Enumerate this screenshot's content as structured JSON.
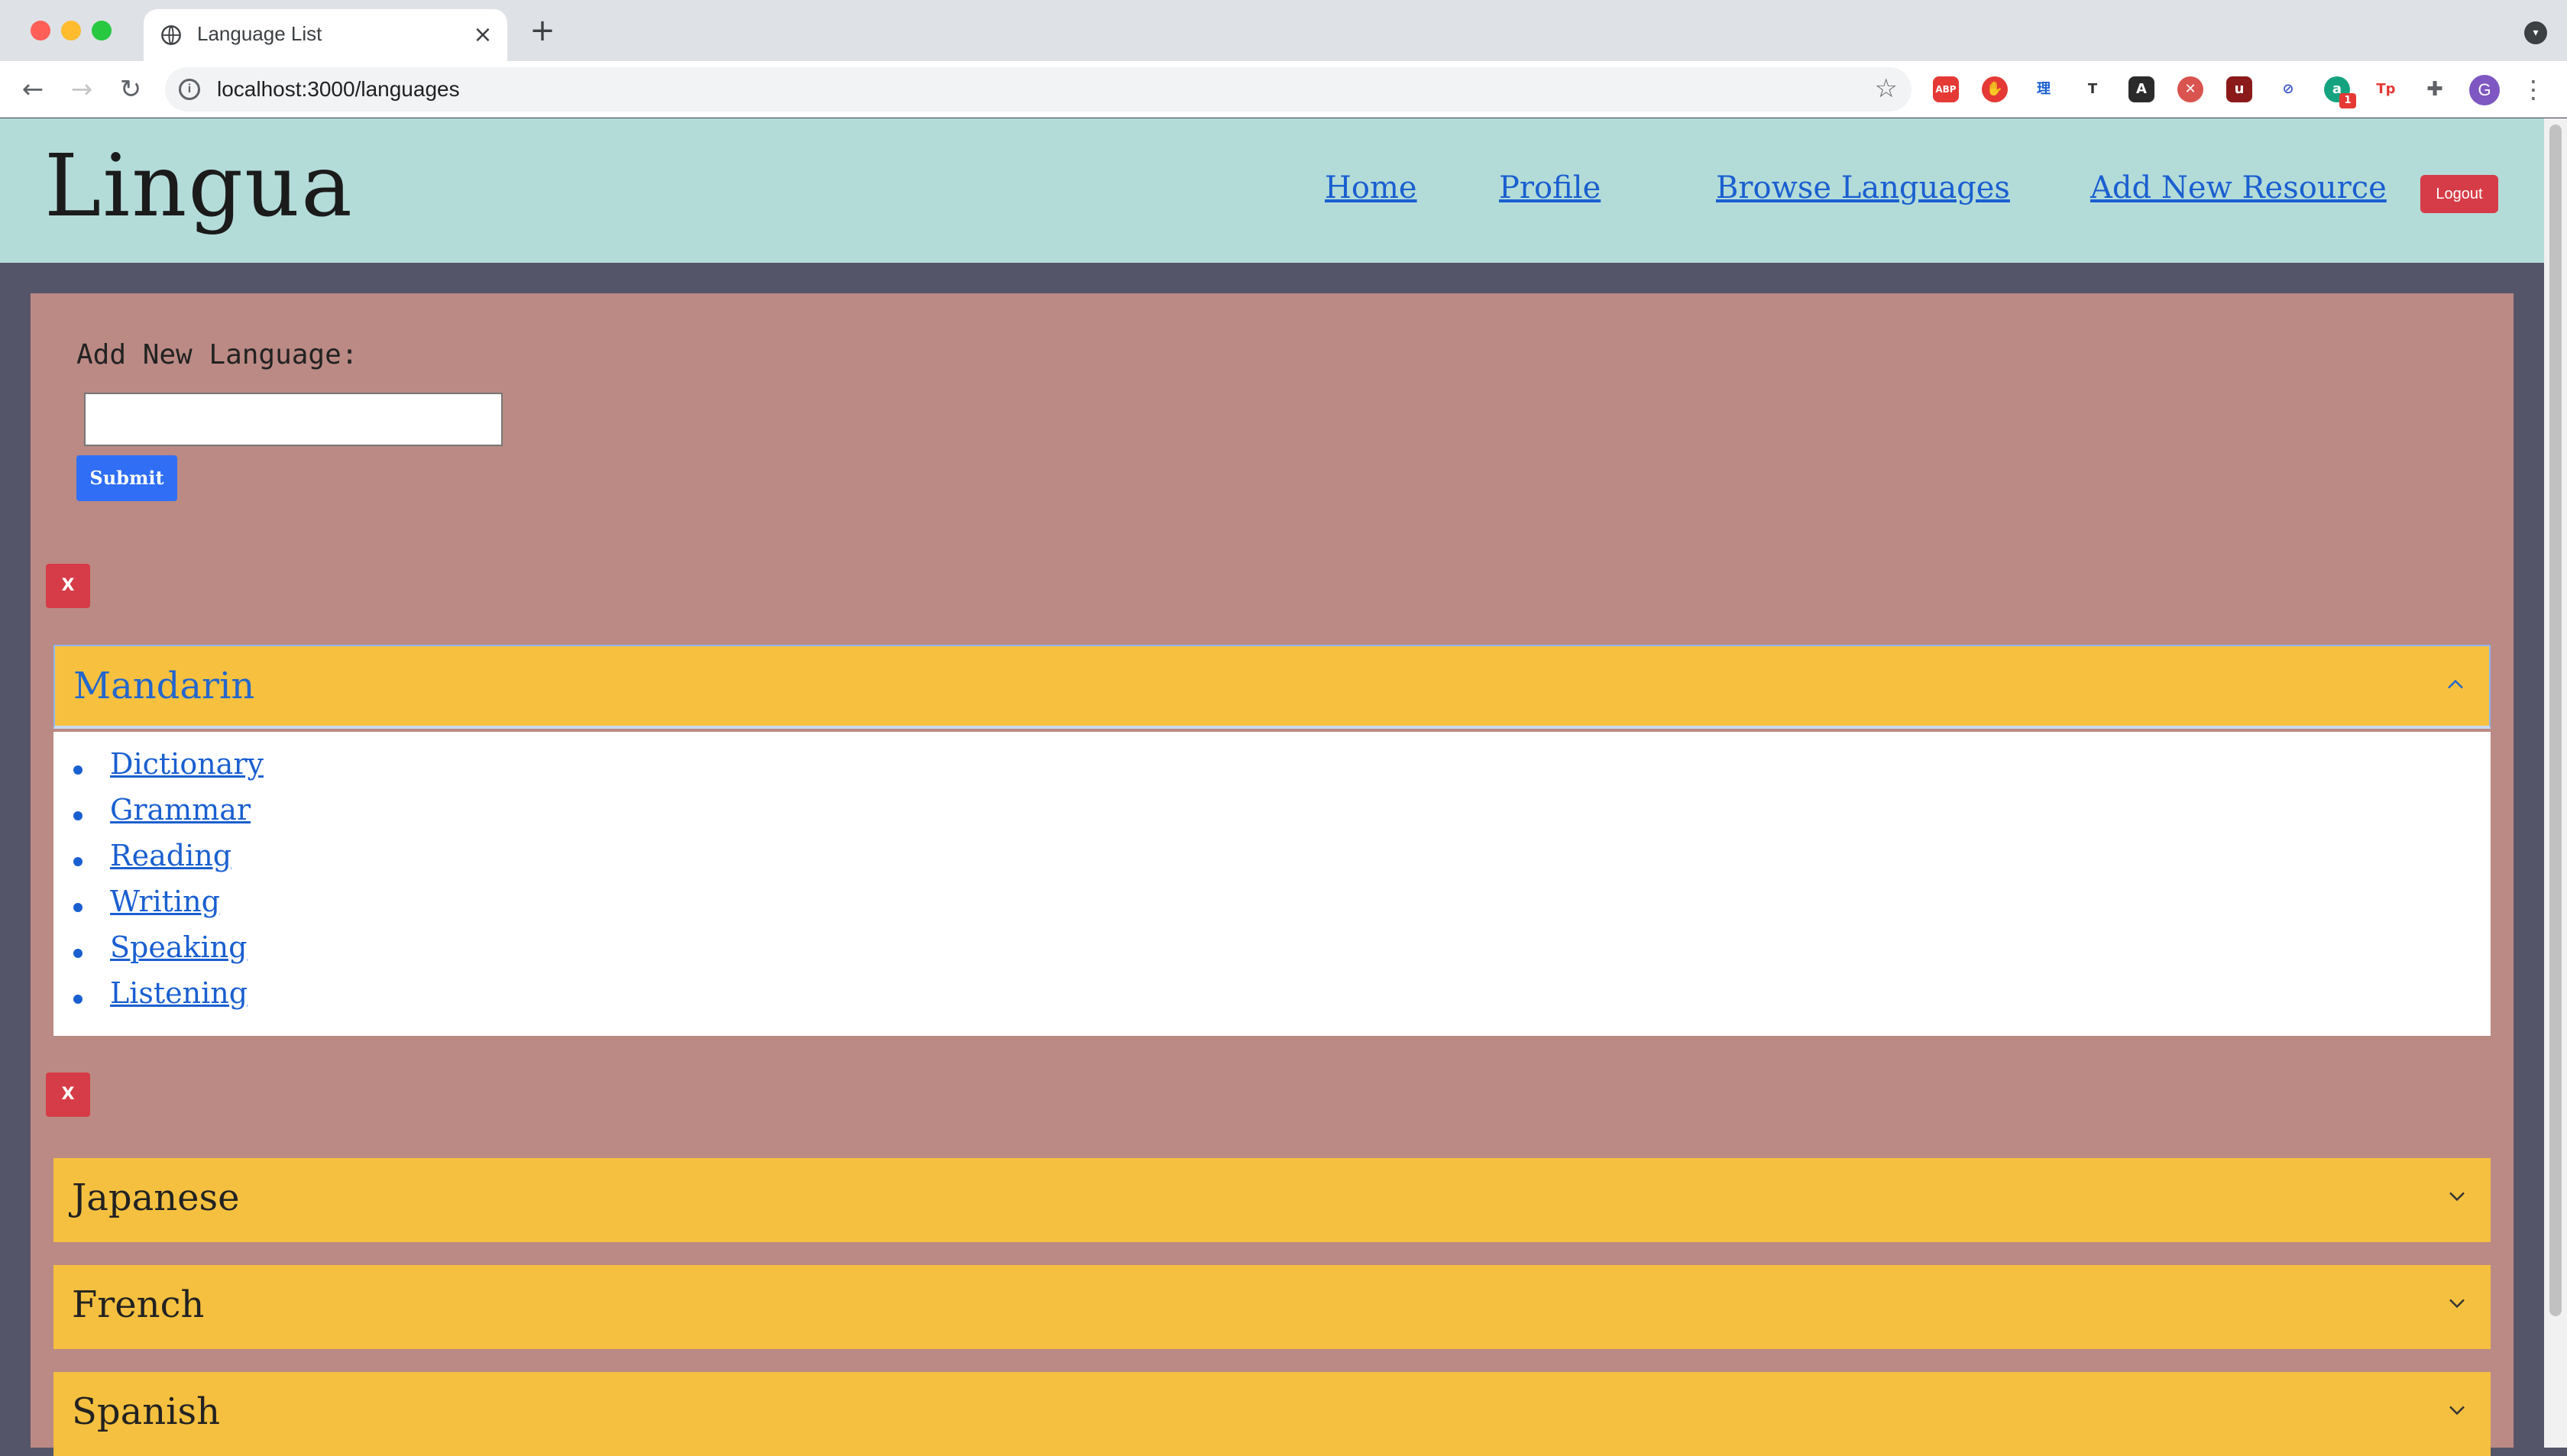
{
  "browser": {
    "tab_title": "Language List",
    "url": "localhost:3000/languages",
    "profile_initial": "G",
    "extension_badge": "1",
    "extensions": [
      "abp-icon",
      "stop-hand-icon",
      "grid-icon",
      "translate-icon",
      "dictionary-icon",
      "circle-x-icon",
      "shield-icon",
      "block-icon",
      "grammar-icon",
      "tp-icon",
      "puzzle-icon"
    ]
  },
  "site": {
    "logo": "Lingua",
    "nav": {
      "home": "Home",
      "profile": "Profile",
      "browse": "Browse Languages",
      "add_resource": "Add New Resource"
    },
    "logout": "Logout"
  },
  "form": {
    "label": "Add New Language:",
    "input_value": "",
    "submit": "Submit"
  },
  "languages": [
    {
      "name": "Mandarin",
      "expanded": true,
      "delete_label": "X",
      "resources": [
        "Dictionary",
        "Grammar",
        "Reading",
        "Writing",
        "Speaking",
        "Listening"
      ]
    },
    {
      "name": "Japanese",
      "expanded": false,
      "delete_label": "X"
    },
    {
      "name": "French",
      "expanded": false
    },
    {
      "name": "Spanish",
      "expanded": false
    }
  ],
  "colors": {
    "header_bg": "#b3dcd9",
    "panel_bg": "#bb8a84",
    "accordion_bg": "#f5c03f",
    "link": "#1a5fd0",
    "danger": "#d63c47",
    "primary": "#2f6ef5",
    "page_bg": "#55556a"
  }
}
